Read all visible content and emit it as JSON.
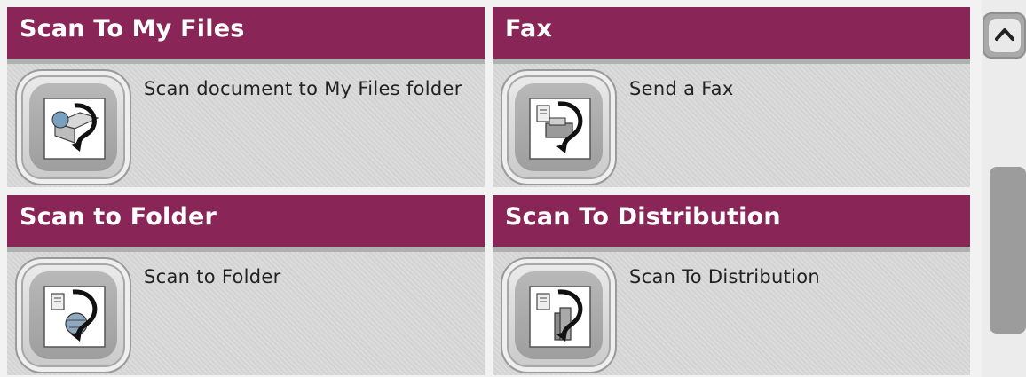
{
  "tiles": [
    {
      "title": "Scan To My Files",
      "description": "Scan document to  My Files folder",
      "icon": "scan-to-my-files-icon"
    },
    {
      "title": "Fax",
      "description": "Send a Fax",
      "icon": "fax-icon"
    },
    {
      "title": "Scan to Folder",
      "description": "Scan to Folder",
      "icon": "scan-to-folder-icon"
    },
    {
      "title": "Scan To Distribution",
      "description": "Scan To Distribution",
      "icon": "scan-to-distribution-icon"
    }
  ],
  "scrollbar": {
    "up_icon": "chevron-up-icon"
  },
  "colors": {
    "header": "#8a2557",
    "tile_bg": "#dadada",
    "header_border": "#b0b0b0"
  }
}
